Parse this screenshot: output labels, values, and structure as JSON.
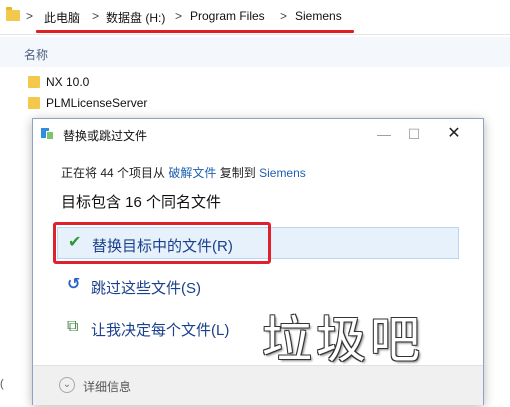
{
  "explorer": {
    "breadcrumb": [
      "此电脑",
      "数据盘 (H:)",
      "Program Files",
      "Siemens"
    ],
    "separator": ">",
    "column_header": "名称",
    "files": [
      "NX 10.0",
      "PLMLicenseServer"
    ],
    "side_mark": "("
  },
  "dialog": {
    "title": "替换或跳过文件",
    "progress": {
      "prefix": "正在将 44 个项目从",
      "source": "破解文件",
      "middle": "复制到",
      "destination": "Siemens"
    },
    "summary": "目标包含 16 个同名文件",
    "options": {
      "replace": "替换目标中的文件(R)",
      "skip": "跳过这些文件(S)",
      "decide": "让我决定每个文件(L)"
    },
    "footer": {
      "details": "详细信息"
    }
  },
  "watermark": "垃圾吧",
  "icons": {
    "folder": "folder-icon",
    "check": "check-icon",
    "skip": "skip-arrow-icon",
    "decide": "compare-files-icon",
    "chevron": "chevron-down-icon",
    "close": "close-icon"
  },
  "colors": {
    "accent_red": "#e0202a",
    "link_blue": "#1f5fb3",
    "option_text": "#1a3f8c",
    "selected_bg": "#e6f1fb"
  }
}
